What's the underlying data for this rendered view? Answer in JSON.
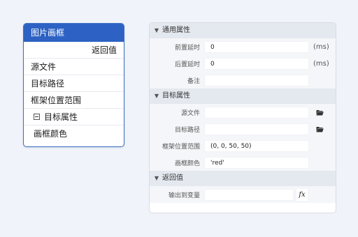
{
  "node": {
    "title": "图片画框",
    "return_label": "返回值",
    "ports": [
      "源文件",
      "目标路径",
      "框架位置范围"
    ],
    "group_label": "目标属性",
    "color_label": "画框颜色"
  },
  "panel": {
    "sections": [
      {
        "title": "通用属性",
        "rows": [
          {
            "label": "前置延时",
            "value": "0",
            "suffix": "(ms)"
          },
          {
            "label": "后置延时",
            "value": "0",
            "suffix": "(ms)"
          },
          {
            "label": "备注",
            "value": ""
          }
        ]
      },
      {
        "title": "目标属性",
        "rows": [
          {
            "label": "源文件",
            "value": "",
            "icon": "folder-open-icon"
          },
          {
            "label": "目标路径",
            "value": "",
            "icon": "folder-open-icon"
          },
          {
            "label": "框架位置范围",
            "value": "(0, 0, 50, 50)"
          },
          {
            "label": "画框颜色",
            "value": "'red'"
          }
        ]
      },
      {
        "title": "返回值",
        "rows": [
          {
            "label": "输出到变量",
            "value": "",
            "icon": "fx-icon",
            "icon_glyph": "fx"
          }
        ]
      }
    ]
  },
  "colors": {
    "accent": "#2d62c4",
    "section_bg": "#e4e8ef",
    "page_bg": "#f0f3f9"
  }
}
